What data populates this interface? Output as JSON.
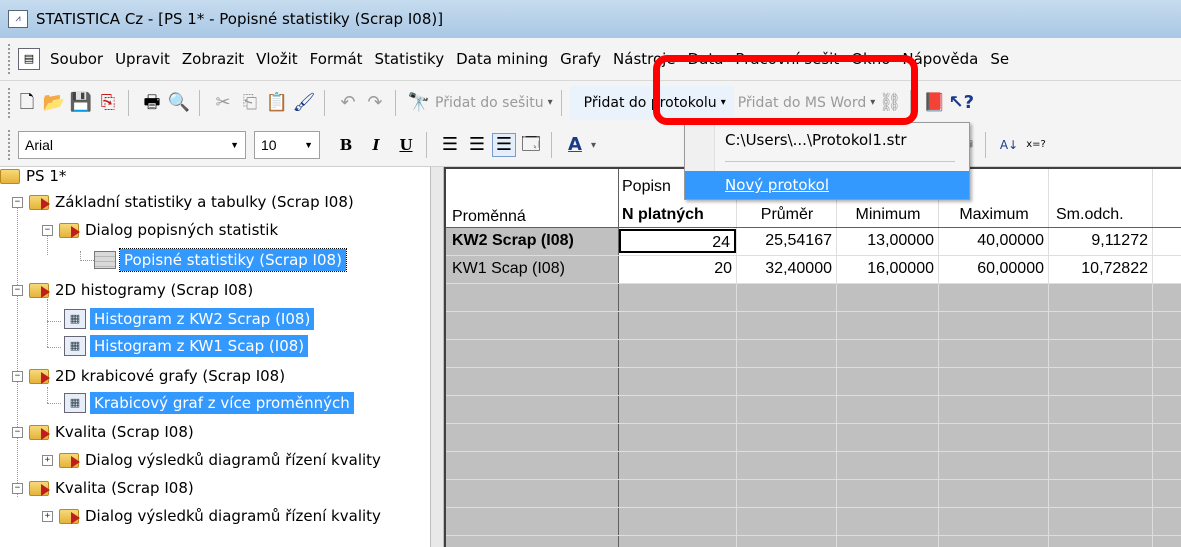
{
  "window": {
    "title": "STATISTICA Cz - [PS 1* - Popisné statistiky (Scrap I08)]",
    "app_icon": "statistica-app-icon"
  },
  "menubar": {
    "items": [
      "Soubor",
      "Upravit",
      "Zobrazit",
      "Vložit",
      "Formát",
      "Statistiky",
      "Data mining",
      "Grafy",
      "Nástroje",
      "Data",
      "Pracovní sešit",
      "Okno",
      "Nápověda",
      "Se"
    ]
  },
  "toolbar1": {
    "pridat_do_sesitu": "Přidat do sešitu",
    "pridat_do_protokolu": "Přidat do protokolu",
    "pridat_do_ms_word": "Přidat do MS Word"
  },
  "toolbar2": {
    "font_name": "Arial",
    "font_size": "10",
    "bold": "B",
    "italic": "I",
    "underline": "U"
  },
  "tree": {
    "root": "PS 1*",
    "zakladni": "Základní statistiky a tabulky (Scrap I08)",
    "dialog_popisnych": "Dialog popisných statistik",
    "popisne_statistiky": "Popisné statistiky (Scrap I08)",
    "histogramy": "2D histogramy (Scrap I08)",
    "histogram_kw2": "Histogram z KW2 Scrap (I08)",
    "histogram_kw1": "Histogram z KW1 Scap (I08)",
    "krabicove": "2D krabicové grafy (Scrap I08)",
    "krabicovy_graf": "Krabicový graf z více proměnných",
    "kvalita1": "Kvalita (Scrap I08)",
    "dialog_kvality1": "Dialog výsledků diagramů řízení kvality",
    "kvalita2": "Kvalita (Scrap I08)",
    "dialog_kvality2": "Dialog výsledků diagramů řízení kvality"
  },
  "sheet": {
    "title": "Popisn",
    "row_header_label": "Proměnná",
    "columns": [
      "N platných",
      "Průměr",
      "Minimum",
      "Maximum",
      "Sm.odch."
    ],
    "rows": [
      {
        "name": "KW2 Scrap (I08)",
        "values": [
          "24",
          "25,54167",
          "13,00000",
          "40,00000",
          "9,11272"
        ]
      },
      {
        "name": "KW1 Scap (I08)",
        "values": [
          "20",
          "32,40000",
          "16,00000",
          "60,00000",
          "10,72822"
        ]
      }
    ]
  },
  "dropdown": {
    "recent": "C:\\Users\\...\\Protokol1.str",
    "new": "Nový protokol"
  },
  "colors": {
    "selection": "#3399ff",
    "annotation": "#ff0000",
    "sheet_bg": "#c0c0c0"
  }
}
